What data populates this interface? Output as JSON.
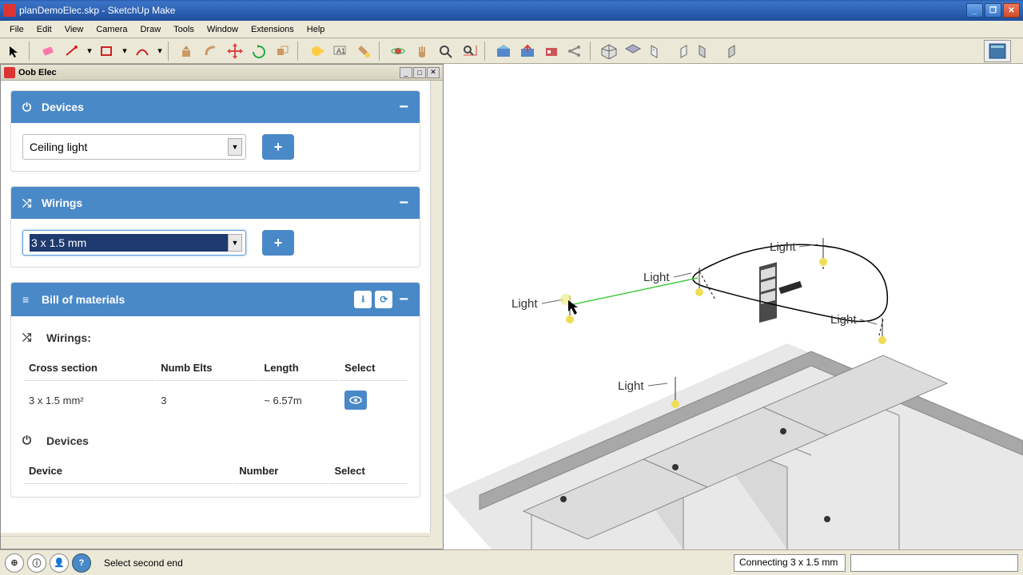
{
  "window": {
    "title": "planDemoElec.skp - SketchUp Make"
  },
  "menu": [
    "File",
    "Edit",
    "View",
    "Camera",
    "Draw",
    "Tools",
    "Window",
    "Extensions",
    "Help"
  ],
  "panel": {
    "title": "Oob Elec",
    "devices": {
      "header": "Devices",
      "select": "Ceiling light"
    },
    "wirings": {
      "header": "Wirings",
      "select": "3 x 1.5 mm"
    },
    "bom": {
      "header": "Bill of materials",
      "wirings_section": "Wirings",
      "wirings_cols": {
        "c1": "Cross section",
        "c2": "Numb Elts",
        "c3": "Length",
        "c4": "Select"
      },
      "wirings_row": {
        "c1": "3 x 1.5 mm²",
        "c2": "3",
        "c3": "~ 6.57m"
      },
      "devices_section": "Devices",
      "devices_cols": {
        "c1": "Device",
        "c2": "Number",
        "c3": "Select"
      }
    }
  },
  "viewport": {
    "light_label": "Light"
  },
  "status": {
    "hint": "Select second end",
    "right": "Connecting 3 x 1.5 mm"
  }
}
